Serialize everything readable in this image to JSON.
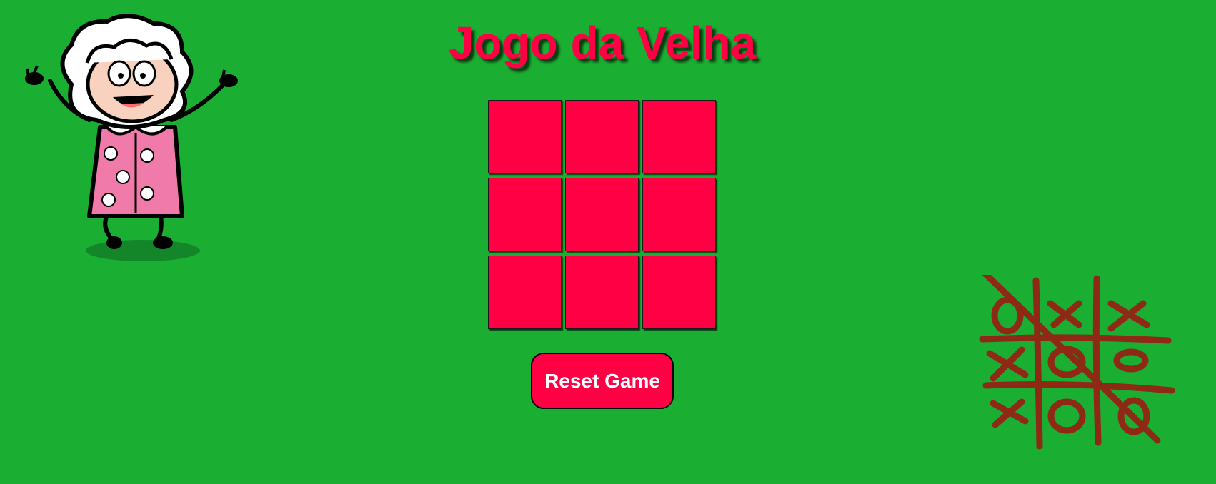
{
  "page": {
    "title": "Jogo da Velha",
    "background_color": "#1aae32",
    "accent_color": "#ff0044"
  },
  "board": {
    "cells": [
      "",
      "",
      "",
      "",
      "",
      "",
      "",
      "",
      ""
    ]
  },
  "controls": {
    "reset_label": "Reset Game"
  },
  "decorations": {
    "left_image": "cartoon-grandma-icon",
    "right_image": "tic-tac-toe-sketch-icon"
  }
}
